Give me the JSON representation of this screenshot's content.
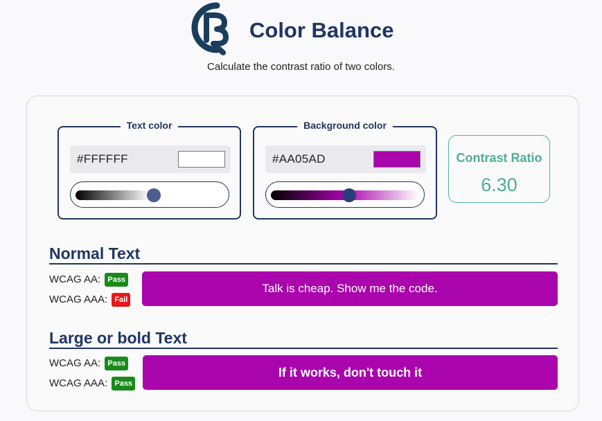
{
  "header": {
    "title": "Color Balance",
    "subtitle": "Calculate the contrast ratio of two colors.",
    "logo_icon": "cb-logo-icon",
    "logo_color": "#1a3d5c"
  },
  "text_color": {
    "legend": "Text color",
    "hex": "#FFFFFF",
    "swatch": "#FFFFFF",
    "slider_level": 0.5
  },
  "background_color": {
    "legend": "Background color",
    "hex": "#AA05AD",
    "swatch": "#AA05AD",
    "slider_level": 0.5
  },
  "contrast": {
    "label": "Contrast Ratio",
    "value": "6.30",
    "color": "#4fae95"
  },
  "normal_text": {
    "title": "Normal Text",
    "aa_label": "WCAG AA:",
    "aa_result": "Pass",
    "aaa_label": "WCAG AAA:",
    "aaa_result": "Fail",
    "sample": "Talk is cheap. Show me the code."
  },
  "large_text": {
    "title": "Large or bold Text",
    "aa_label": "WCAG AA:",
    "aa_result": "Pass",
    "aaa_label": "WCAG AAA:",
    "aaa_result": "Pass",
    "sample": "If it works, don't touch it"
  },
  "colors": {
    "heading": "#1f3565",
    "pass": "#1a8a1a",
    "fail": "#e81818",
    "preview_bg": "#AA05AD",
    "preview_text": "#FFFFFF",
    "slider_thumb_text": "#4a5f8f",
    "slider_thumb_bg": "#2a3f7a"
  }
}
